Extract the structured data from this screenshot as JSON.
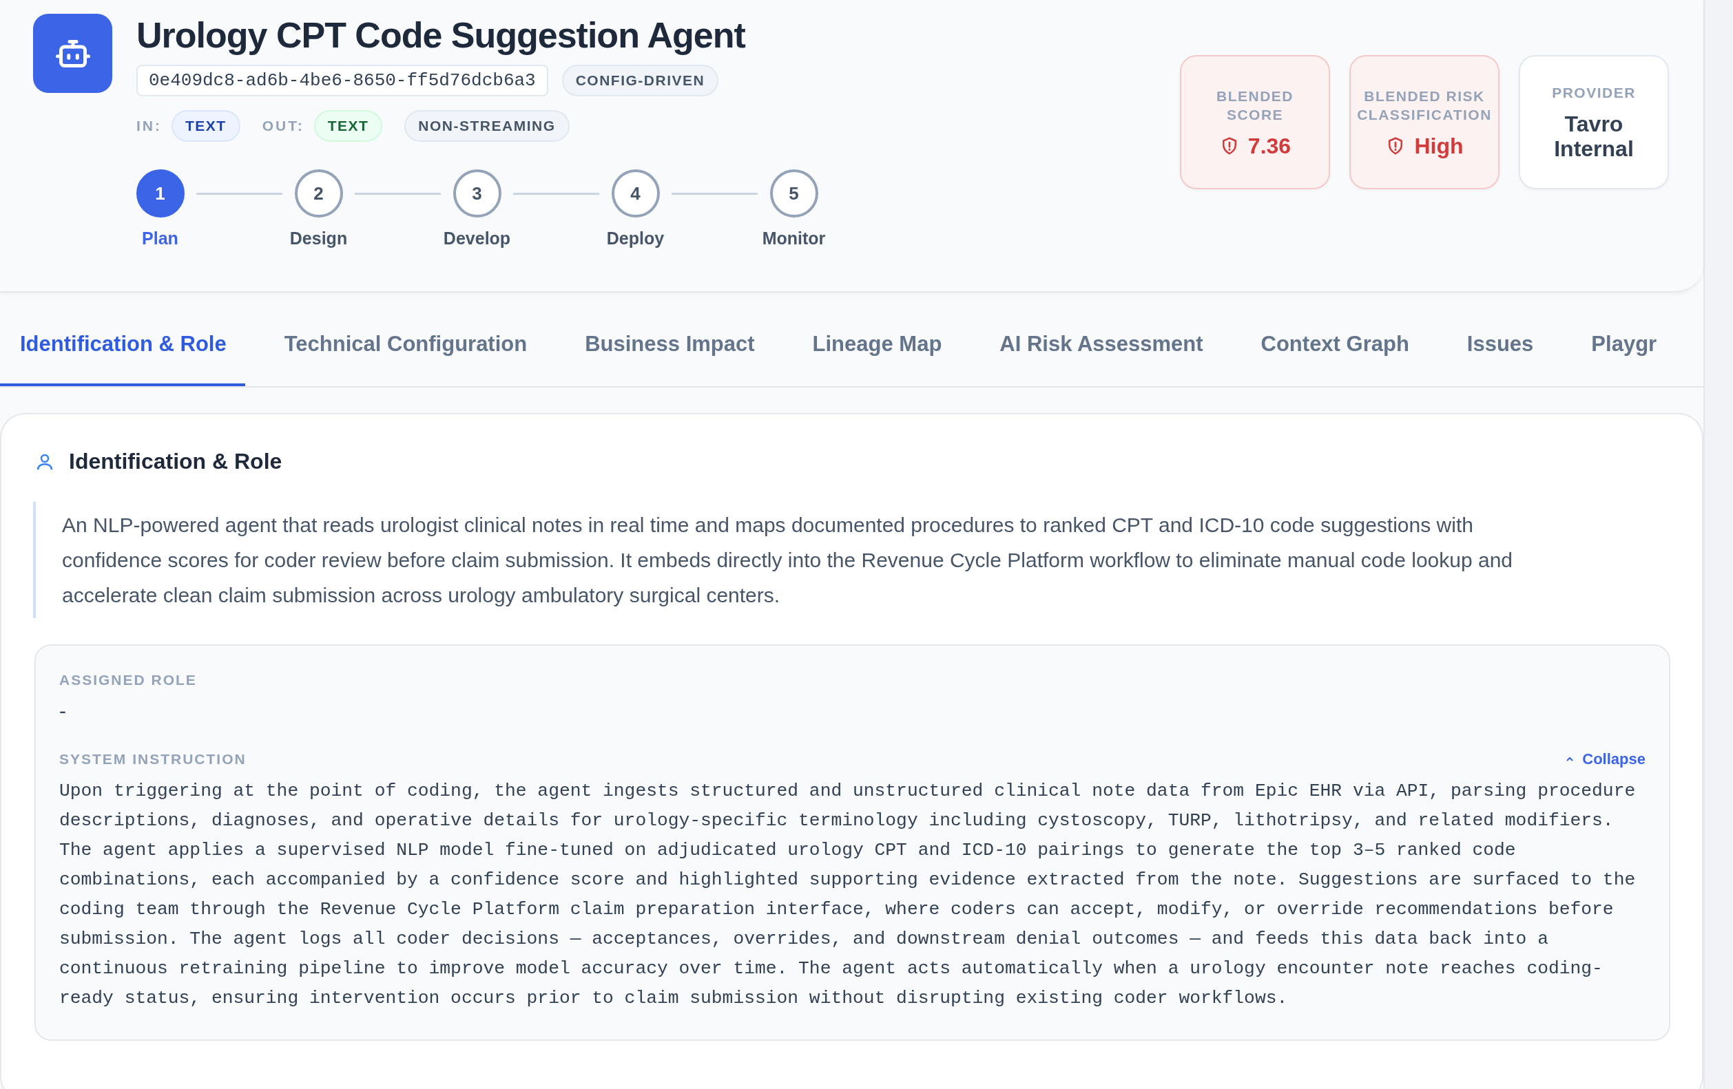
{
  "header": {
    "title": "Urology CPT Code Suggestion Agent",
    "id": "0e409dc8-ad6b-4be6-8650-ff5d76dcb6a3",
    "mode_badge": "CONFIG-DRIVEN",
    "io": [
      {
        "label": "IN:",
        "value": "TEXT",
        "kind": "input"
      },
      {
        "label": "OUT:",
        "value": "TEXT",
        "kind": "output"
      }
    ],
    "streaming_badge": "NON-STREAMING",
    "steps": [
      {
        "number": "1",
        "label": "Plan",
        "selected": true
      },
      {
        "number": "2",
        "label": "Design",
        "selected": false
      },
      {
        "number": "3",
        "label": "Develop",
        "selected": false
      },
      {
        "number": "4",
        "label": "Deploy",
        "selected": false
      },
      {
        "number": "5",
        "label": "Monitor",
        "selected": false
      }
    ],
    "stat_cards": [
      {
        "label": "BLENDED SCORE",
        "value": "7.36",
        "kind": "risk"
      },
      {
        "label": "BLENDED RISK CLASSIFICATION",
        "value": "High",
        "kind": "risk"
      },
      {
        "label": "PROVIDER",
        "value": "Tavro Internal",
        "kind": "plain"
      }
    ]
  },
  "tabs": [
    {
      "label": "Identification & Role",
      "selected": true
    },
    {
      "label": "Technical Configuration",
      "selected": false
    },
    {
      "label": "Business Impact",
      "selected": false
    },
    {
      "label": "Lineage Map",
      "selected": false
    },
    {
      "label": "AI Risk Assessment",
      "selected": false
    },
    {
      "label": "Context Graph",
      "selected": false
    },
    {
      "label": "Issues",
      "selected": false
    },
    {
      "label": "Playgr",
      "selected": false
    }
  ],
  "section": {
    "title": "Identification & Role",
    "description": "An NLP-powered agent that reads urologist clinical notes in real time and maps documented procedures to ranked CPT and ICD-10 code suggestions with confidence scores for coder review before claim submission. It embeds directly into the Revenue Cycle Platform workflow to eliminate manual code lookup and accelerate clean claim submission across urology ambulatory surgical centers.",
    "assigned_role": {
      "label": "ASSIGNED ROLE",
      "value": "-"
    },
    "system_instruction": {
      "label": "SYSTEM INSTRUCTION",
      "toggle": "Collapse",
      "expanded": true,
      "text": "Upon triggering at the point of coding, the agent ingests structured and unstructured clinical note data from Epic EHR via API, parsing procedure descriptions, diagnoses, and operative details for urology-specific terminology including cystoscopy, TURP, lithotripsy, and related modifiers. The agent applies a supervised NLP model fine-tuned on adjudicated urology CPT and ICD-10 pairings to generate the top 3–5 ranked code combinations, each accompanied by a confidence score and highlighted supporting evidence extracted from the note. Suggestions are surfaced to the coding team through the Revenue Cycle Platform claim preparation interface, where coders can accept, modify, or override recommendations before submission. The agent logs all coder decisions — acceptances, overrides, and downstream denial outcomes — and feeds this data back into a continuous retraining pipeline to improve model accuracy over time. The agent acts automatically when a urology encounter note reaches coding-ready status, ensuring intervention occurs prior to claim submission without disrupting existing coder workflows."
    }
  }
}
